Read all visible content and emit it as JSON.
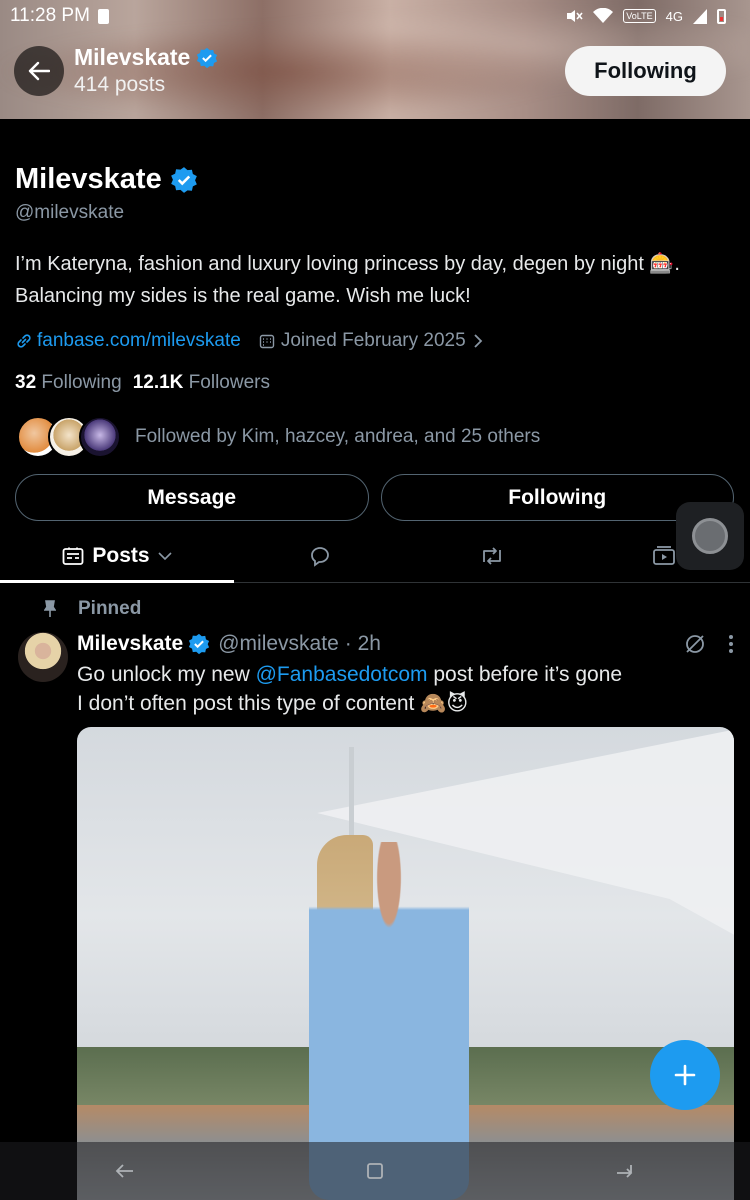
{
  "status_bar": {
    "time": "11:28 PM",
    "network": "4G",
    "volte": "VoLTE"
  },
  "header": {
    "name": "Milevskate",
    "posts_count": "414 posts",
    "follow_button": "Following"
  },
  "profile": {
    "display_name": "Milevskate",
    "handle": "@milevskate",
    "bio": "I’m Kateryna,  fashion and luxury loving princess by day, degen by night 🎰. Balancing my sides is the real game. Wish me luck!",
    "link": "fanbase.com/milevskate",
    "joined": "Joined February 2025",
    "following_count": "32",
    "following_label": "Following",
    "followers_count": "12.1K",
    "followers_label": "Followers",
    "followed_by": "Followed by Kim, hazcey, andrea, and 25 others"
  },
  "actions": {
    "message": "Message",
    "following": "Following"
  },
  "tabs": {
    "posts": "Posts"
  },
  "post": {
    "pinned_label": "Pinned",
    "author": "Milevskate",
    "handle": "@milevskate",
    "time": "· 2h",
    "text_before": "Go unlock my new ",
    "mention": "@Fanbasedotcom",
    "text_after": " post before it’s gone",
    "text_line2": "I don’t often post this type of content 🙈😈"
  },
  "colors": {
    "accent": "#1d9bf0",
    "background": "#000000",
    "muted": "#8b98a5"
  }
}
